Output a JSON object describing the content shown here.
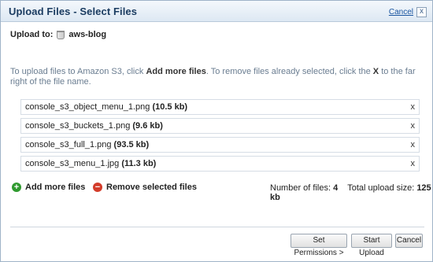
{
  "dialog": {
    "title": "Upload Files - Select Files",
    "cancel_label": "Cancel",
    "close_glyph": "x"
  },
  "upload_to": {
    "label": "Upload to:",
    "bucket_icon": "bucket-icon",
    "bucket": "aws-blog"
  },
  "info": {
    "part1": "To upload files to Amazon S3, click ",
    "add_more": "Add more files",
    "part2": ". To remove files already selected, click the ",
    "x": "X",
    "part3": " to the far right of the file name."
  },
  "files": [
    {
      "name": "console_s3_object_menu_1.png",
      "size": "(10.5 kb)",
      "remove": "x"
    },
    {
      "name": "console_s3_buckets_1.png",
      "size": "(9.6 kb)",
      "remove": "x"
    },
    {
      "name": "console_s3_full_1.png",
      "size": "(93.5 kb)",
      "remove": "x"
    },
    {
      "name": "console_s3_menu_1.jpg",
      "size": "(11.3 kb)",
      "remove": "x"
    }
  ],
  "actions": {
    "add_label": "Add more files",
    "add_glyph": "+",
    "remove_label": "Remove selected files",
    "remove_glyph": "−"
  },
  "summary": {
    "files_label": "Number of files:",
    "files_value": "4",
    "size_label": "Total upload size:",
    "size_value": "125 kb"
  },
  "buttons": {
    "set_permissions": "Set Permissions >",
    "start_upload": "Start Upload",
    "cancel": "Cancel"
  },
  "colors": {
    "title_text": "#1b3c61",
    "link": "#1a55a0",
    "info_text": "#6a7d91",
    "add_icon": "#2f9a2f",
    "remove_icon": "#d33c2a"
  }
}
